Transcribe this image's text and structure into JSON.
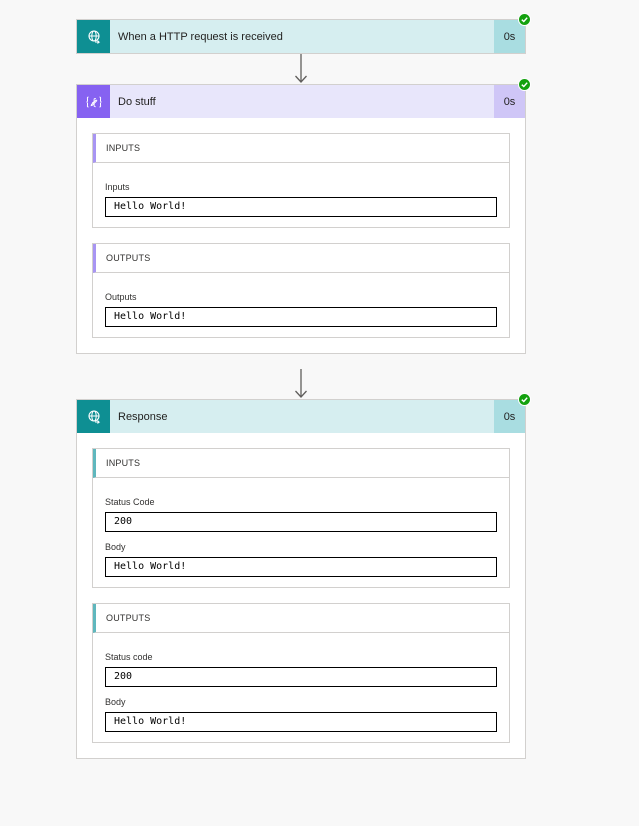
{
  "steps": [
    {
      "title": "When a HTTP request is received",
      "duration": "0s",
      "icon": "globe-icon",
      "status": "succeeded"
    },
    {
      "title": "Do stuff",
      "duration": "0s",
      "icon": "compose-icon",
      "status": "succeeded",
      "inputs": {
        "heading": "INPUTS",
        "fields": [
          {
            "label": "Inputs",
            "value": "Hello World!"
          }
        ]
      },
      "outputs": {
        "heading": "OUTPUTS",
        "fields": [
          {
            "label": "Outputs",
            "value": "Hello World!"
          }
        ]
      }
    },
    {
      "title": "Response",
      "duration": "0s",
      "icon": "globe-icon",
      "status": "succeeded",
      "inputs": {
        "heading": "INPUTS",
        "fields": [
          {
            "label": "Status Code",
            "value": "200"
          },
          {
            "label": "Body",
            "value": "Hello World!"
          }
        ]
      },
      "outputs": {
        "heading": "OUTPUTS",
        "fields": [
          {
            "label": "Status code",
            "value": "200"
          },
          {
            "label": "Body",
            "value": "Hello World!"
          }
        ]
      }
    }
  ],
  "colors": {
    "teal_accent": "#0e8f93",
    "purple_accent": "#8662f1",
    "success": "#13a10e"
  }
}
